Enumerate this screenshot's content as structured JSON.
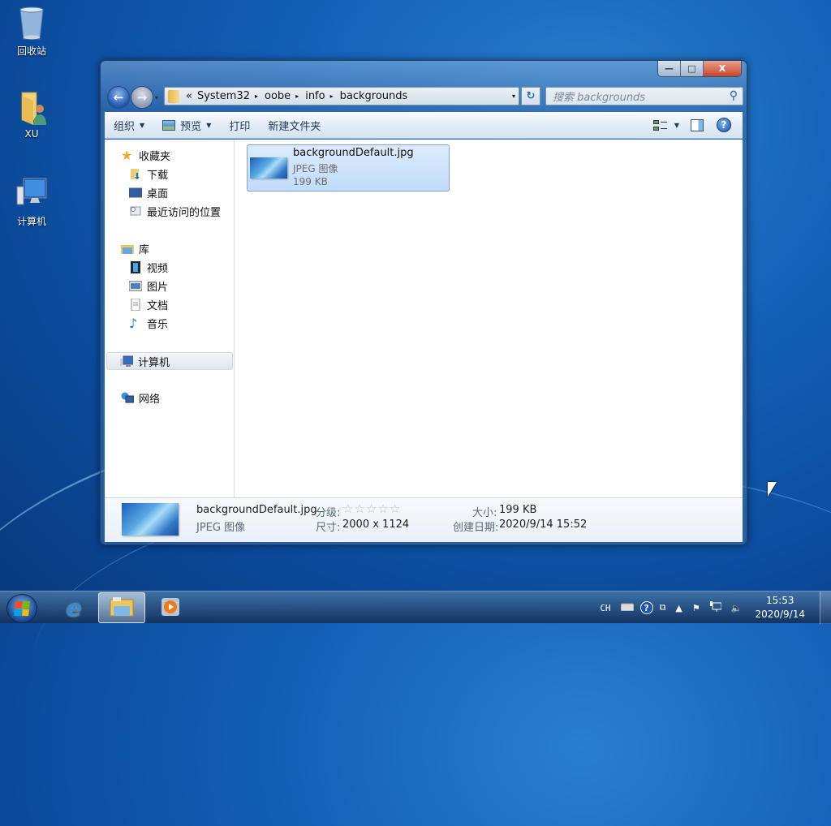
{
  "desktop": {
    "icons": [
      {
        "label": "回收站",
        "icon": "recycle-bin-icon"
      },
      {
        "label": "XU",
        "icon": "user-folder-icon"
      },
      {
        "label": "计算机",
        "icon": "computer-icon"
      }
    ]
  },
  "window": {
    "caption_buttons": {
      "minimize": "—",
      "maximize": "□",
      "close": "X"
    },
    "nav": {
      "back": "←",
      "forward": "→",
      "history_dropdown": "▾"
    },
    "address": {
      "overflow": "«",
      "segments": [
        "System32",
        "oobe",
        "info",
        "backgrounds"
      ],
      "separator": "▸",
      "dropdown": "▾"
    },
    "refresh": "↻",
    "search": {
      "placeholder": "搜索 backgrounds",
      "icon": "⚲"
    },
    "toolbar": {
      "organize": "组织",
      "preview": "预览",
      "print": "打印",
      "new_folder": "新建文件夹",
      "dropdown_arrow": "▼",
      "help": "?"
    },
    "navpane": {
      "favorites": {
        "label": "收藏夹",
        "items": [
          "下载",
          "桌面",
          "最近访问的位置"
        ]
      },
      "libraries": {
        "label": "库",
        "items": [
          "视频",
          "图片",
          "文档",
          "音乐"
        ]
      },
      "computer": "计算机",
      "network": "网络"
    },
    "files": [
      {
        "name": "backgroundDefault.jpg",
        "type": "JPEG 图像",
        "size": "199 KB",
        "selected": true
      }
    ],
    "details": {
      "name": "backgroundDefault.jpg",
      "type": "JPEG 图像",
      "rating_label": "分级:",
      "rating": 0,
      "rating_max": 5,
      "star": "☆",
      "dimensions_label": "尺寸:",
      "dimensions": "2000 x 1124",
      "size_label": "大小:",
      "size": "199 KB",
      "created_label": "创建日期:",
      "created": "2020/9/14 15:52"
    }
  },
  "taskbar": {
    "apps": [
      {
        "name": "Internet Explorer",
        "icon": "ie-icon",
        "active": false
      },
      {
        "name": "Windows Explorer",
        "icon": "explorer-icon",
        "active": true
      },
      {
        "name": "Windows Media Player",
        "icon": "media-player-icon",
        "active": false
      }
    ],
    "tray": {
      "language": "CH",
      "time": "15:53",
      "date": "2020/9/14"
    }
  }
}
